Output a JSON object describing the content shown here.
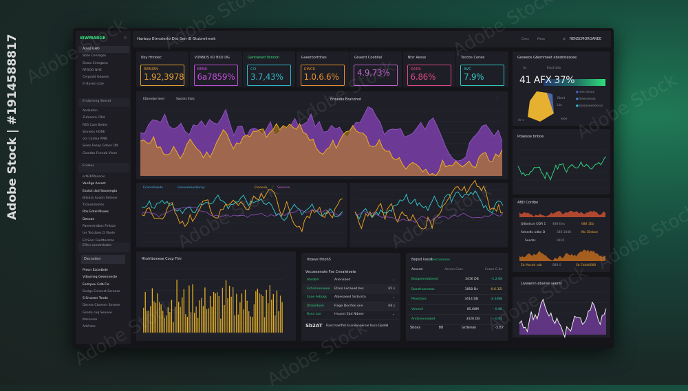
{
  "watermark": "Adobe Stock | #1914588817",
  "watermark_tile": "Adobe Stock",
  "sidebar": {
    "brand": "WWMARGE",
    "items": [
      "Alasd GHO",
      "Sbbs Centeges",
      "Slaws Ceregbea",
      "RFGOO NHE",
      "Cerpodd Geqees",
      "Ill Bases coze"
    ],
    "section1_title": "Endzmeng Seeset",
    "section1_items": [
      "Aedaaten",
      "Zufeanm CRN",
      "RES Carn Bedte",
      "Sinnees HORE",
      "ots Caidea RNN",
      "Slees Feeqs Gdasn DN",
      "Ctoedzs Fcevab Vloes"
    ],
    "section2_title": "Endees",
    "section2_items": [
      "ertEdPPacenis",
      "VanRgs Ascest",
      "Eastot dad Sasoengto",
      "Bdsdzs Aaaon Seteser",
      "Ticleasdoetes",
      "Rhs Edrel Mvaes",
      "Deseae",
      "Panenendbes Fellaze",
      "ter Tecstoes D Vbele",
      "Ed Sosr Faoltterzzos"
    ],
    "section3_title": "Effen canetrdnsbe",
    "section3_input": "Decnstisn",
    "section3_items": [
      "Pteon Ezcedbde",
      "Vdasmeg Geesnneste",
      "Eadcpeu Gdb Fle",
      "Seslgs Cnnecst Seroase",
      "S Srnoren Tsnde",
      "Decets Ctoesen Sosene",
      "Gsedo ceq Seanee",
      "Msscesro",
      "AdVntss"
    ]
  },
  "header": {
    "title": "Harbop Etmoterlo Dto Sen IE-Stubrelimek",
    "controls": [
      "Cens",
      "Piess"
    ],
    "user": "RENSCMORGANEE"
  },
  "kpis": [
    {
      "label": "Nsy Hnnbec",
      "sub": "RENIRN",
      "value": "1.92,3978",
      "color": "#e0a030"
    },
    {
      "label": "VUNNDS IIO BSO DG",
      "sub": "BENK",
      "value": "6a7859%",
      "color": "#c050d8"
    },
    {
      "label": "Gantianed Vonnon",
      "sub": "CO",
      "value": "3.7,43%",
      "color": "#2fb8c8",
      "label_color": "#3be07a"
    },
    {
      "label": "Gaeerborfdnes",
      "sub": "UWCK",
      "value": "1.0.6.6%",
      "color": "#e8902c"
    },
    {
      "label": "Gnaerd Coebhel",
      "sub": "",
      "value": "4.9,73%",
      "color": "#c060d0"
    },
    {
      "label": "Ntsr Aesse",
      "sub": "DARK",
      "value": "6.86%",
      "color": "#e04888"
    },
    {
      "label": "Teocbs Cenee",
      "sub": "AVC",
      "value": "7.9%",
      "color": "#30c8c0"
    }
  ],
  "main_chart": {
    "legend": [
      "Etbrenbe leed",
      "Sasnhs Eisis"
    ],
    "title": "Enbedts Brahdrod"
  },
  "mid_left": {
    "legend": [
      "Ecacesbaede",
      "Geseeeseesbonsy"
    ],
    "legend2": [
      "Eteoeee",
      "Sonesse"
    ]
  },
  "bottom_left": {
    "title": "Rhshtbonese Cocp Fhtr"
  },
  "bottom_mid": {
    "title": "Ihoeve thtoh5",
    "subtitle": "Vecoesenute Fse Cnealeloete",
    "rows": [
      [
        "Ahrobm",
        "Anenabed",
        ""
      ],
      [
        "Echosnenaeee",
        "Efsoo Lecaeed bes",
        "65 s"
      ],
      [
        "Eaae Feboqs",
        "Albeeaeed Ssdorstn",
        ""
      ],
      [
        "Dtsoedaen",
        "Fiage Decrfeo one",
        "68 s"
      ],
      [
        "Rsnn acn",
        "Hnuest Ebd Nlbeer",
        ""
      ]
    ],
    "footer": "Rancmaefflot Essneeaaeroel Ruco Dpene",
    "footer_value": "Sb2AT",
    "footer_extra": "CH"
  },
  "bottom_right": {
    "title": "Bepsd Isexd",
    "title_tag": "Berccessnne",
    "headers": [
      "Aesessl",
      "Aeress Cese",
      "Ceaes G de"
    ],
    "rows": [
      [
        "Basgennedzesed",
        "3416 DB",
        "-1.2.68"
      ],
      [
        "Basafrsaneeos",
        "3858 Ds",
        "-0.6.3ZI"
      ],
      [
        "Pleesfans",
        "3414 DB",
        "-3.3488"
      ],
      [
        "Velcsch",
        "85.68M",
        "- 0.88"
      ],
      [
        "Andsnenoeaed",
        "3428 DB",
        "- 0.81"
      ]
    ],
    "footer": [
      "Sboas",
      "88",
      "Grdenan",
      "-3.87"
    ]
  },
  "right_top": {
    "title": "Geseeos Gbemmeet ebodnbesoee",
    "big": "41 AFX 37%",
    "small": "As",
    "tag": "Fasd Unb",
    "legend": [
      "ees eeses",
      "Eeeseeeas",
      "Eeoaneedesecs"
    ],
    "labels": [
      "Ar s",
      "Ebnd",
      "Ltn",
      "Ieoe"
    ]
  },
  "right_2": {
    "title": "Pdaesoe bnboe"
  },
  "right_3": {
    "title": "ABD Cordbe",
    "rows": [
      "Qdbotsce ODR 1",
      "Adnedtc odbe D",
      "Seedss",
      "Eb Mosdd sdb"
    ],
    "vals": [
      "488 Eea",
      "388 1848",
      "9910",
      "888 0"
    ],
    "vals2": [
      "688 1Eb",
      "Nb 3Beboe",
      "",
      "Sb Eddb8080"
    ]
  },
  "right_4": {
    "title": "Liveaenn ebanse seemt"
  },
  "colors": {
    "purple": "#7a3fa8",
    "orange": "#e6a020",
    "green": "#2ed07a",
    "teal": "#30c0c0",
    "accent": "#2ee07c"
  }
}
